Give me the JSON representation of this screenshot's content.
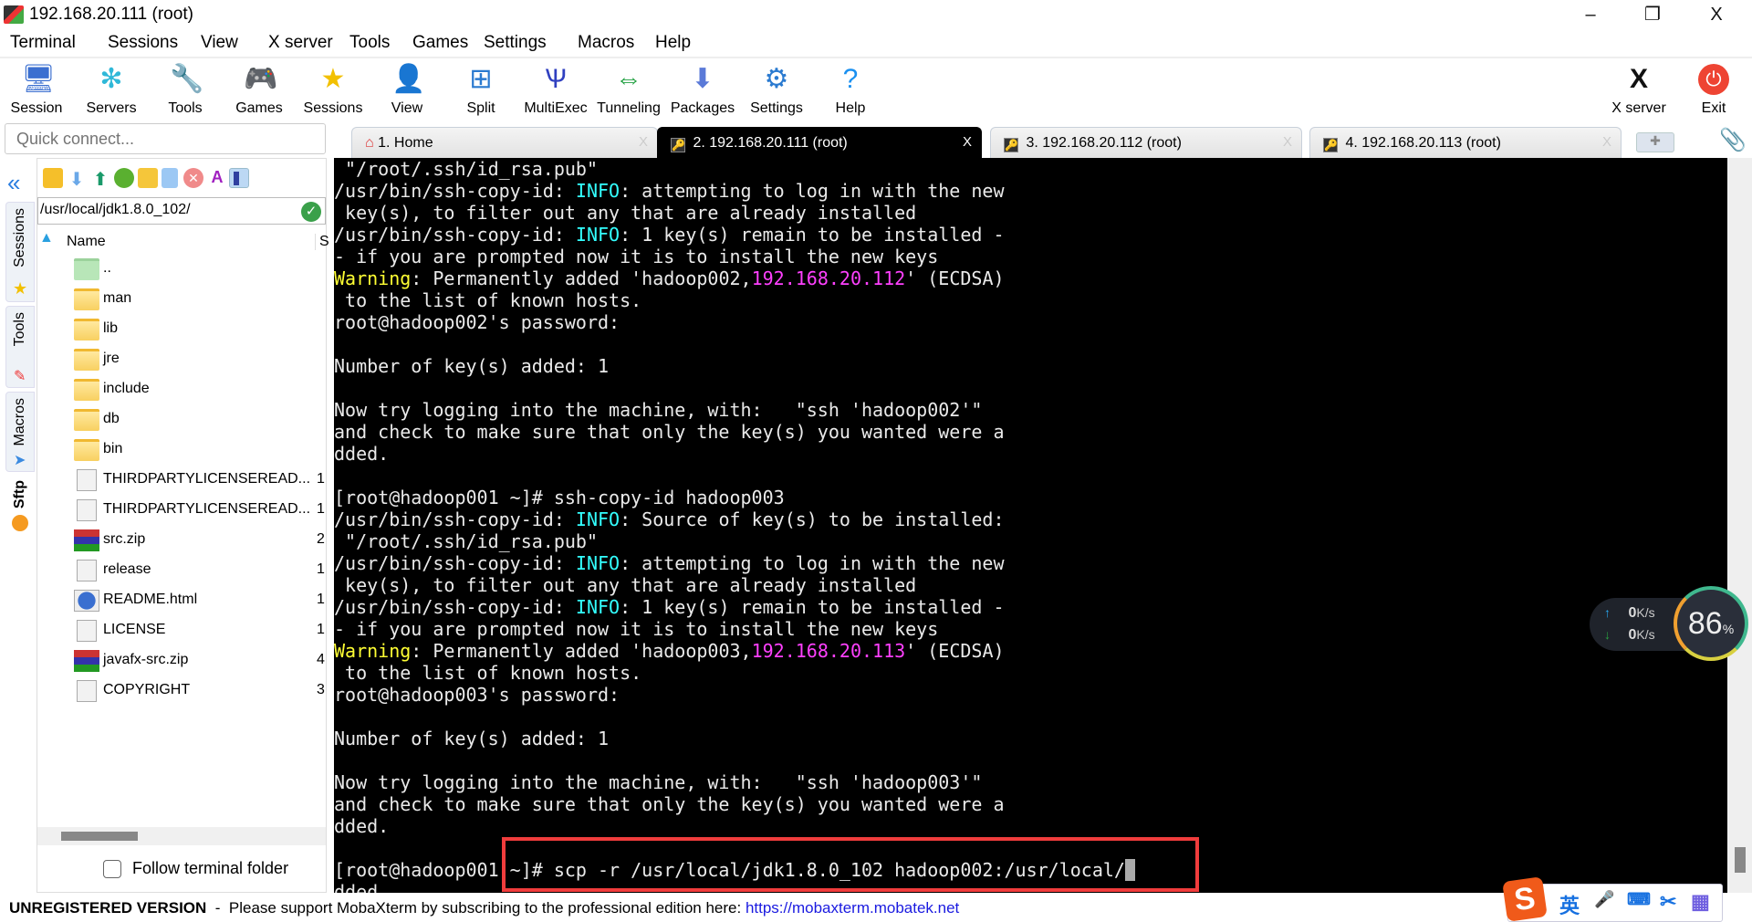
{
  "window": {
    "title": "192.168.20.111 (root)",
    "minimize": "–",
    "restore": "❐",
    "close": "X"
  },
  "menu": [
    "Terminal",
    "Sessions",
    "View",
    "X server",
    "Tools",
    "Games",
    "Settings",
    "Macros",
    "Help"
  ],
  "toolbar": [
    {
      "label": "Session",
      "icon": "session-icon",
      "glyph": "🖥"
    },
    {
      "label": "Servers",
      "icon": "servers-icon",
      "glyph": "✻"
    },
    {
      "label": "Tools",
      "icon": "tools-icon",
      "glyph": "🔧"
    },
    {
      "label": "Games",
      "icon": "games-icon",
      "glyph": "🎮"
    },
    {
      "label": "Sessions",
      "icon": "star-icon",
      "glyph": "★"
    },
    {
      "label": "View",
      "icon": "view-icon",
      "glyph": "👤"
    },
    {
      "label": "Split",
      "icon": "split-icon",
      "glyph": "⊞"
    },
    {
      "label": "MultiExec",
      "icon": "multiexec-icon",
      "glyph": "Ѱ"
    },
    {
      "label": "Tunneling",
      "icon": "tunneling-icon",
      "glyph": "⇔"
    },
    {
      "label": "Packages",
      "icon": "packages-icon",
      "glyph": "⬇"
    },
    {
      "label": "Settings",
      "icon": "settings-icon",
      "glyph": "⚙"
    },
    {
      "label": "Help",
      "icon": "help-icon",
      "glyph": "?"
    }
  ],
  "toolbar_right": [
    {
      "label": "X server",
      "icon": "xserver-icon",
      "glyph": "X"
    },
    {
      "label": "Exit",
      "icon": "power-icon",
      "glyph": "⏻"
    }
  ],
  "quick_connect": {
    "placeholder": "Quick connect..."
  },
  "tabs": [
    {
      "label": "1. Home",
      "active": false
    },
    {
      "label": "2. 192.168.20.111 (root)",
      "active": true
    },
    {
      "label": "3. 192.168.20.112 (root)",
      "active": false
    },
    {
      "label": "4. 192.168.20.113 (root)",
      "active": false
    }
  ],
  "tab_close": "X",
  "side_tabs": [
    "Sessions",
    "Tools",
    "Macros",
    "Sftp"
  ],
  "sftp": {
    "path": "/usr/local/jdk1.8.0_102/",
    "columns": {
      "name": "Name",
      "size": "S"
    },
    "files": [
      {
        "name": "..",
        "type": "up",
        "size": ""
      },
      {
        "name": "man",
        "type": "folder",
        "size": ""
      },
      {
        "name": "lib",
        "type": "folder",
        "size": ""
      },
      {
        "name": "jre",
        "type": "folder",
        "size": ""
      },
      {
        "name": "include",
        "type": "folder",
        "size": ""
      },
      {
        "name": "db",
        "type": "folder",
        "size": ""
      },
      {
        "name": "bin",
        "type": "folder",
        "size": ""
      },
      {
        "name": "THIRDPARTYLICENSEREAD...",
        "type": "doc",
        "size": "1"
      },
      {
        "name": "THIRDPARTYLICENSEREAD...",
        "type": "doc",
        "size": "1"
      },
      {
        "name": "src.zip",
        "type": "zip",
        "size": "2"
      },
      {
        "name": "release",
        "type": "doc",
        "size": "1"
      },
      {
        "name": "README.html",
        "type": "html",
        "size": "1"
      },
      {
        "name": "LICENSE",
        "type": "doc",
        "size": "1"
      },
      {
        "name": "javafx-src.zip",
        "type": "zip",
        "size": "4"
      },
      {
        "name": "COPYRIGHT",
        "type": "doc",
        "size": "3"
      }
    ],
    "follow_label": "Follow terminal folder",
    "follow_checked": false
  },
  "terminal": {
    "colors": {
      "default": "#eaeaea",
      "info": "#33ffff",
      "warning": "#ffff33",
      "ip": "#ff40ff"
    },
    "lines": [
      [
        {
          "t": " \"/root/.ssh/id_rsa.pub\""
        }
      ],
      [
        {
          "t": "/usr/bin/ssh-copy-id: "
        },
        {
          "t": "INFO",
          "c": "info"
        },
        {
          "t": ": attempting to log in with the new"
        }
      ],
      [
        {
          "t": " key(s), to filter out any that are already installed"
        }
      ],
      [
        {
          "t": "/usr/bin/ssh-copy-id: "
        },
        {
          "t": "INFO",
          "c": "info"
        },
        {
          "t": ": 1 key(s) remain to be installed -"
        }
      ],
      [
        {
          "t": "- if you are prompted now it is to install the new keys"
        }
      ],
      [
        {
          "t": "Warning",
          "c": "warning"
        },
        {
          "t": ": Permanently added 'hadoop002,"
        },
        {
          "t": "192.168.20.112",
          "c": "ip"
        },
        {
          "t": "' (ECDSA)"
        }
      ],
      [
        {
          "t": " to the list of known hosts."
        }
      ],
      [
        {
          "t": "root@hadoop002's password:"
        }
      ],
      [],
      [
        {
          "t": "Number of key(s) added: 1"
        }
      ],
      [],
      [
        {
          "t": "Now try logging into the machine, with:   \"ssh 'hadoop002'\""
        }
      ],
      [
        {
          "t": "and check to make sure that only the key(s) you wanted were a"
        }
      ],
      [
        {
          "t": "dded."
        }
      ],
      [],
      [
        {
          "t": "[root@hadoop001 ~]# ssh-copy-id hadoop003"
        }
      ],
      [
        {
          "t": "/usr/bin/ssh-copy-id: "
        },
        {
          "t": "INFO",
          "c": "info"
        },
        {
          "t": ": Source of key(s) to be installed:"
        }
      ],
      [
        {
          "t": " \"/root/.ssh/id_rsa.pub\""
        }
      ],
      [
        {
          "t": "/usr/bin/ssh-copy-id: "
        },
        {
          "t": "INFO",
          "c": "info"
        },
        {
          "t": ": attempting to log in with the new"
        }
      ],
      [
        {
          "t": " key(s), to filter out any that are already installed"
        }
      ],
      [
        {
          "t": "/usr/bin/ssh-copy-id: "
        },
        {
          "t": "INFO",
          "c": "info"
        },
        {
          "t": ": 1 key(s) remain to be installed -"
        }
      ],
      [
        {
          "t": "- if you are prompted now it is to install the new keys"
        }
      ],
      [
        {
          "t": "Warning",
          "c": "warning"
        },
        {
          "t": ": Permanently added 'hadoop003,"
        },
        {
          "t": "192.168.20.113",
          "c": "ip"
        },
        {
          "t": "' (ECDSA)"
        }
      ],
      [
        {
          "t": " to the list of known hosts."
        }
      ],
      [
        {
          "t": "root@hadoop003's password:"
        }
      ],
      [],
      [
        {
          "t": "Number of key(s) added: 1"
        }
      ],
      [],
      [
        {
          "t": "Now try logging into the machine, with:   \"ssh 'hadoop003'\""
        }
      ],
      [
        {
          "t": "and check to make sure that only the key(s) you wanted were a"
        }
      ],
      [
        {
          "t": "dded."
        }
      ],
      [],
      [
        {
          "t": "[root@hadoop001 ~]# scp -r /usr/local/jdk1.8.0_102 hadoop002:/usr/local/"
        },
        {
          "cursor": true
        }
      ],
      [
        {
          "t": "dded"
        }
      ]
    ],
    "highlight_color": "#f03c3c"
  },
  "net_widget": {
    "up": "0",
    "down": "0",
    "unit": "K/s",
    "percent": "86",
    "percent_sign": "%"
  },
  "status": {
    "unregistered": "UNREGISTERED VERSION",
    "dash": " - ",
    "message": "Please support MobaXterm by subscribing to the professional edition here: ",
    "link": "https://mobaxterm.mobatek.net"
  },
  "ime": {
    "lang": "英",
    "items": [
      "🎤",
      "⌨",
      "✂",
      "▦"
    ]
  }
}
